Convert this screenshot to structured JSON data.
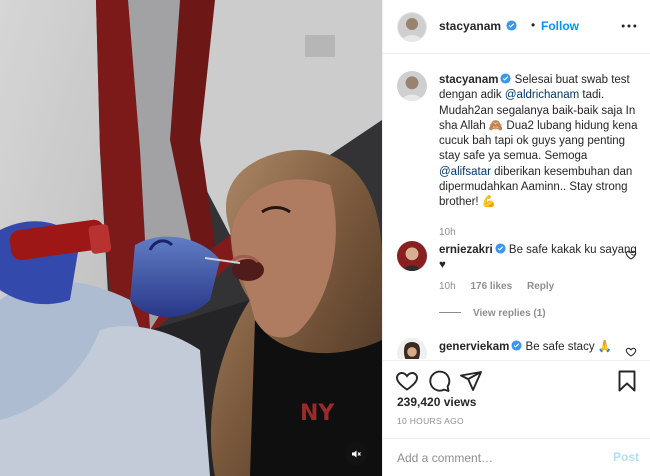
{
  "post": {
    "username": "stacyanam",
    "dot": "•",
    "follow_label": "Follow",
    "caption": {
      "username": "stacyanam",
      "part1": "Selesai buat swab test dengan adik ",
      "mention1": "@aldrichanam",
      "part2": " tadi. Mudah2an segalanya baik-baik saja In sha Allah 🙈 Dua2 lubang hidung kena cucuk bah tapi ok guys yang penting stay safe ya semua. Semoga ",
      "mention2": "@alifsatar",
      "part3": " diberikan kesembuhan dan dipermudahkan Aaminn.. Stay strong brother! 💪",
      "time": "10h"
    },
    "comments": [
      {
        "username": "erniezakri",
        "text": "Be safe kakak ku sayang ♥",
        "time": "10h",
        "likes": "176 likes",
        "reply": "Reply",
        "view_replies": "View replies (1)"
      },
      {
        "username": "generviekam",
        "text": "Be safe stacy 🙏"
      }
    ],
    "views": "239,420 views",
    "time_ago": "10 HOURS AGO",
    "add_comment_placeholder": "Add a comment…",
    "post_label": "Post"
  },
  "icons": {
    "verified": "verified-badge-icon",
    "more": "more-options-icon",
    "like": "heart-icon",
    "comment": "comment-icon",
    "share": "share-icon",
    "save": "bookmark-icon",
    "mute": "muted-speaker-icon"
  },
  "colors": {
    "link": "#0095f6",
    "mention": "#00376b",
    "muted_text": "#8e8e8e",
    "post_disabled": "#b2dffc"
  }
}
